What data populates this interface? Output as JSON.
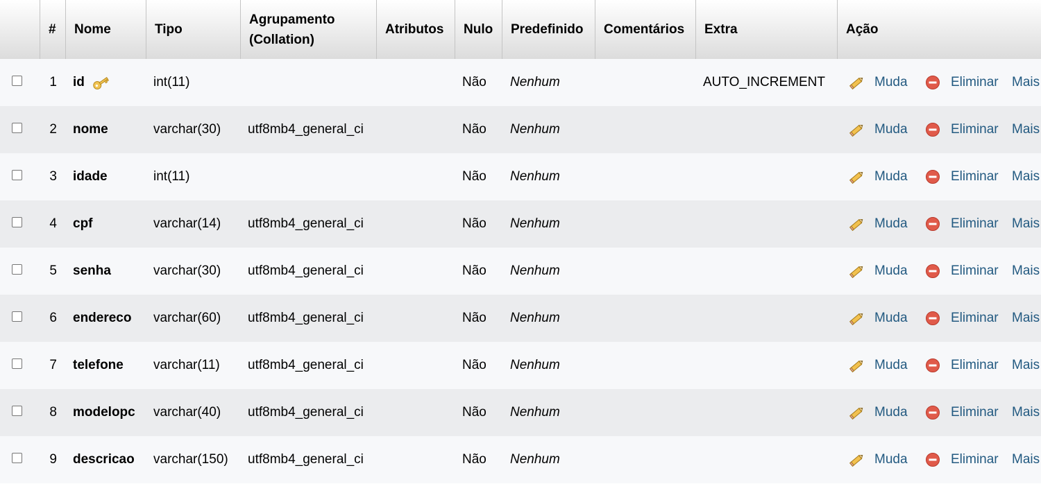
{
  "header": {
    "hash": "#",
    "nome": "Nome",
    "tipo": "Tipo",
    "agrupamento_line1": "Agrupamento",
    "agrupamento_line2": "(Collation)",
    "atributos": "Atributos",
    "nulo": "Nulo",
    "predefinido": "Predefinido",
    "comentarios": "Comentários",
    "extra": "Extra",
    "acao": "Ação"
  },
  "actions": {
    "edit": "Muda",
    "drop": "Eliminar",
    "more": "Mais"
  },
  "rows": [
    {
      "num": "1",
      "name": "id",
      "type": "int(11)",
      "collation": "",
      "null": "Não",
      "default": "Nenhum",
      "extra": "AUTO_INCREMENT",
      "primary_key": true
    },
    {
      "num": "2",
      "name": "nome",
      "type": "varchar(30)",
      "collation": "utf8mb4_general_ci",
      "null": "Não",
      "default": "Nenhum",
      "extra": ""
    },
    {
      "num": "3",
      "name": "idade",
      "type": "int(11)",
      "collation": "",
      "null": "Não",
      "default": "Nenhum",
      "extra": ""
    },
    {
      "num": "4",
      "name": "cpf",
      "type": "varchar(14)",
      "collation": "utf8mb4_general_ci",
      "null": "Não",
      "default": "Nenhum",
      "extra": ""
    },
    {
      "num": "5",
      "name": "senha",
      "type": "varchar(30)",
      "collation": "utf8mb4_general_ci",
      "null": "Não",
      "default": "Nenhum",
      "extra": ""
    },
    {
      "num": "6",
      "name": "endereco",
      "type": "varchar(60)",
      "collation": "utf8mb4_general_ci",
      "null": "Não",
      "default": "Nenhum",
      "extra": ""
    },
    {
      "num": "7",
      "name": "telefone",
      "type": "varchar(11)",
      "collation": "utf8mb4_general_ci",
      "null": "Não",
      "default": "Nenhum",
      "extra": ""
    },
    {
      "num": "8",
      "name": "modelopc",
      "type": "varchar(40)",
      "collation": "utf8mb4_general_ci",
      "null": "Não",
      "default": "Nenhum",
      "extra": ""
    },
    {
      "num": "9",
      "name": "descricao",
      "type": "varchar(150)",
      "collation": "utf8mb4_general_ci",
      "null": "Não",
      "default": "Nenhum",
      "extra": ""
    }
  ],
  "colors": {
    "link": "#235a81",
    "row_odd": "#f7f8fa",
    "row_even": "#ebecee",
    "drop_icon": "#e05a4a",
    "key_icon": "#e8b84a"
  },
  "icons": {
    "edit": "pencil-icon",
    "drop": "drop-circle-icon",
    "primary_key": "key-icon"
  }
}
